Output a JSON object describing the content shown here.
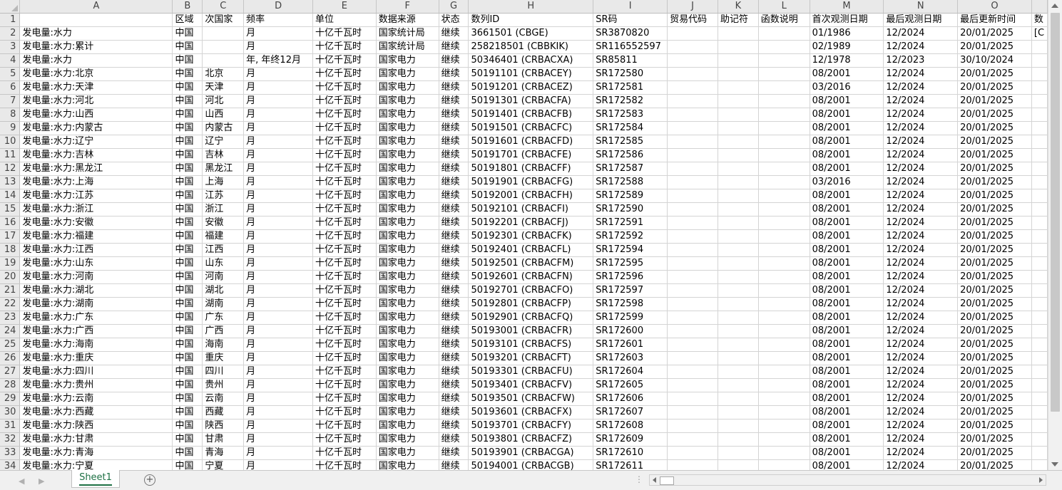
{
  "columns": [
    "A",
    "B",
    "C",
    "D",
    "E",
    "F",
    "G",
    "H",
    "I",
    "J",
    "K",
    "L",
    "M",
    "N",
    "O",
    ""
  ],
  "header_row": [
    "",
    "区域",
    "次国家",
    "频率",
    "单位",
    "数据来源",
    "状态",
    "数列ID",
    "SR码",
    "贸易代码",
    "助记符",
    "函数说明",
    "首次观测日期",
    "最后观测日期",
    "最后更新时间",
    "数"
  ],
  "rows": [
    [
      "发电量:水力",
      "中国",
      "",
      "月",
      "十亿千瓦时",
      "国家统计局",
      "继续",
      "3661501 (CBGE)",
      "SR3870820",
      "",
      "",
      "",
      "01/1986",
      "12/2024",
      "20/01/2025",
      "[C"
    ],
    [
      "发电量:水力:累计",
      "中国",
      "",
      "月",
      "十亿千瓦时",
      "国家统计局",
      "继续",
      "258218501 (CBBKIK)",
      "SR116552597",
      "",
      "",
      "",
      "02/1989",
      "12/2024",
      "20/01/2025",
      ""
    ],
    [
      "发电量:水力",
      "中国",
      "",
      "年, 年终12月",
      "十亿千瓦时",
      "国家电力",
      "继续",
      "50346401 (CRBACXA)",
      "SR85811",
      "",
      "",
      "",
      "12/1978",
      "12/2023",
      "30/10/2024",
      ""
    ],
    [
      "发电量:水力:北京",
      "中国",
      "北京",
      "月",
      "十亿千瓦时",
      "国家电力",
      "继续",
      "50191101 (CRBACEY)",
      "SR172580",
      "",
      "",
      "",
      "08/2001",
      "12/2024",
      "20/01/2025",
      ""
    ],
    [
      "发电量:水力:天津",
      "中国",
      "天津",
      "月",
      "十亿千瓦时",
      "国家电力",
      "继续",
      "50191201 (CRBACEZ)",
      "SR172581",
      "",
      "",
      "",
      "03/2016",
      "12/2024",
      "20/01/2025",
      ""
    ],
    [
      "发电量:水力:河北",
      "中国",
      "河北",
      "月",
      "十亿千瓦时",
      "国家电力",
      "继续",
      "50191301 (CRBACFA)",
      "SR172582",
      "",
      "",
      "",
      "08/2001",
      "12/2024",
      "20/01/2025",
      ""
    ],
    [
      "发电量:水力:山西",
      "中国",
      "山西",
      "月",
      "十亿千瓦时",
      "国家电力",
      "继续",
      "50191401 (CRBACFB)",
      "SR172583",
      "",
      "",
      "",
      "08/2001",
      "12/2024",
      "20/01/2025",
      ""
    ],
    [
      "发电量:水力:内蒙古",
      "中国",
      "内蒙古",
      "月",
      "十亿千瓦时",
      "国家电力",
      "继续",
      "50191501 (CRBACFC)",
      "SR172584",
      "",
      "",
      "",
      "08/2001",
      "12/2024",
      "20/01/2025",
      ""
    ],
    [
      "发电量:水力:辽宁",
      "中国",
      "辽宁",
      "月",
      "十亿千瓦时",
      "国家电力",
      "继续",
      "50191601 (CRBACFD)",
      "SR172585",
      "",
      "",
      "",
      "08/2001",
      "12/2024",
      "20/01/2025",
      ""
    ],
    [
      "发电量:水力:吉林",
      "中国",
      "吉林",
      "月",
      "十亿千瓦时",
      "国家电力",
      "继续",
      "50191701 (CRBACFE)",
      "SR172586",
      "",
      "",
      "",
      "08/2001",
      "12/2024",
      "20/01/2025",
      ""
    ],
    [
      "发电量:水力:黑龙江",
      "中国",
      "黑龙江",
      "月",
      "十亿千瓦时",
      "国家电力",
      "继续",
      "50191801 (CRBACFF)",
      "SR172587",
      "",
      "",
      "",
      "08/2001",
      "12/2024",
      "20/01/2025",
      ""
    ],
    [
      "发电量:水力:上海",
      "中国",
      "上海",
      "月",
      "十亿千瓦时",
      "国家电力",
      "继续",
      "50191901 (CRBACFG)",
      "SR172588",
      "",
      "",
      "",
      "03/2016",
      "12/2024",
      "20/01/2025",
      ""
    ],
    [
      "发电量:水力:江苏",
      "中国",
      "江苏",
      "月",
      "十亿千瓦时",
      "国家电力",
      "继续",
      "50192001 (CRBACFH)",
      "SR172589",
      "",
      "",
      "",
      "08/2001",
      "12/2024",
      "20/01/2025",
      ""
    ],
    [
      "发电量:水力:浙江",
      "中国",
      "浙江",
      "月",
      "十亿千瓦时",
      "国家电力",
      "继续",
      "50192101 (CRBACFI)",
      "SR172590",
      "",
      "",
      "",
      "08/2001",
      "12/2024",
      "20/01/2025",
      ""
    ],
    [
      "发电量:水力:安徽",
      "中国",
      "安徽",
      "月",
      "十亿千瓦时",
      "国家电力",
      "继续",
      "50192201 (CRBACFJ)",
      "SR172591",
      "",
      "",
      "",
      "08/2001",
      "12/2024",
      "20/01/2025",
      ""
    ],
    [
      "发电量:水力:福建",
      "中国",
      "福建",
      "月",
      "十亿千瓦时",
      "国家电力",
      "继续",
      "50192301 (CRBACFK)",
      "SR172592",
      "",
      "",
      "",
      "08/2001",
      "12/2024",
      "20/01/2025",
      ""
    ],
    [
      "发电量:水力:江西",
      "中国",
      "江西",
      "月",
      "十亿千瓦时",
      "国家电力",
      "继续",
      "50192401 (CRBACFL)",
      "SR172594",
      "",
      "",
      "",
      "08/2001",
      "12/2024",
      "20/01/2025",
      ""
    ],
    [
      "发电量:水力:山东",
      "中国",
      "山东",
      "月",
      "十亿千瓦时",
      "国家电力",
      "继续",
      "50192501 (CRBACFM)",
      "SR172595",
      "",
      "",
      "",
      "08/2001",
      "12/2024",
      "20/01/2025",
      ""
    ],
    [
      "发电量:水力:河南",
      "中国",
      "河南",
      "月",
      "十亿千瓦时",
      "国家电力",
      "继续",
      "50192601 (CRBACFN)",
      "SR172596",
      "",
      "",
      "",
      "08/2001",
      "12/2024",
      "20/01/2025",
      ""
    ],
    [
      "发电量:水力:湖北",
      "中国",
      "湖北",
      "月",
      "十亿千瓦时",
      "国家电力",
      "继续",
      "50192701 (CRBACFO)",
      "SR172597",
      "",
      "",
      "",
      "08/2001",
      "12/2024",
      "20/01/2025",
      ""
    ],
    [
      "发电量:水力:湖南",
      "中国",
      "湖南",
      "月",
      "十亿千瓦时",
      "国家电力",
      "继续",
      "50192801 (CRBACFP)",
      "SR172598",
      "",
      "",
      "",
      "08/2001",
      "12/2024",
      "20/01/2025",
      ""
    ],
    [
      "发电量:水力:广东",
      "中国",
      "广东",
      "月",
      "十亿千瓦时",
      "国家电力",
      "继续",
      "50192901 (CRBACFQ)",
      "SR172599",
      "",
      "",
      "",
      "08/2001",
      "12/2024",
      "20/01/2025",
      ""
    ],
    [
      "发电量:水力:广西",
      "中国",
      "广西",
      "月",
      "十亿千瓦时",
      "国家电力",
      "继续",
      "50193001 (CRBACFR)",
      "SR172600",
      "",
      "",
      "",
      "08/2001",
      "12/2024",
      "20/01/2025",
      ""
    ],
    [
      "发电量:水力:海南",
      "中国",
      "海南",
      "月",
      "十亿千瓦时",
      "国家电力",
      "继续",
      "50193101 (CRBACFS)",
      "SR172601",
      "",
      "",
      "",
      "08/2001",
      "12/2024",
      "20/01/2025",
      ""
    ],
    [
      "发电量:水力:重庆",
      "中国",
      "重庆",
      "月",
      "十亿千瓦时",
      "国家电力",
      "继续",
      "50193201 (CRBACFT)",
      "SR172603",
      "",
      "",
      "",
      "08/2001",
      "12/2024",
      "20/01/2025",
      ""
    ],
    [
      "发电量:水力:四川",
      "中国",
      "四川",
      "月",
      "十亿千瓦时",
      "国家电力",
      "继续",
      "50193301 (CRBACFU)",
      "SR172604",
      "",
      "",
      "",
      "08/2001",
      "12/2024",
      "20/01/2025",
      ""
    ],
    [
      "发电量:水力:贵州",
      "中国",
      "贵州",
      "月",
      "十亿千瓦时",
      "国家电力",
      "继续",
      "50193401 (CRBACFV)",
      "SR172605",
      "",
      "",
      "",
      "08/2001",
      "12/2024",
      "20/01/2025",
      ""
    ],
    [
      "发电量:水力:云南",
      "中国",
      "云南",
      "月",
      "十亿千瓦时",
      "国家电力",
      "继续",
      "50193501 (CRBACFW)",
      "SR172606",
      "",
      "",
      "",
      "08/2001",
      "12/2024",
      "20/01/2025",
      ""
    ],
    [
      "发电量:水力:西藏",
      "中国",
      "西藏",
      "月",
      "十亿千瓦时",
      "国家电力",
      "继续",
      "50193601 (CRBACFX)",
      "SR172607",
      "",
      "",
      "",
      "08/2001",
      "12/2024",
      "20/01/2025",
      ""
    ],
    [
      "发电量:水力:陕西",
      "中国",
      "陕西",
      "月",
      "十亿千瓦时",
      "国家电力",
      "继续",
      "50193701 (CRBACFY)",
      "SR172608",
      "",
      "",
      "",
      "08/2001",
      "12/2024",
      "20/01/2025",
      ""
    ],
    [
      "发电量:水力:甘肃",
      "中国",
      "甘肃",
      "月",
      "十亿千瓦时",
      "国家电力",
      "继续",
      "50193801 (CRBACFZ)",
      "SR172609",
      "",
      "",
      "",
      "08/2001",
      "12/2024",
      "20/01/2025",
      ""
    ],
    [
      "发电量:水力:青海",
      "中国",
      "青海",
      "月",
      "十亿千瓦时",
      "国家电力",
      "继续",
      "50193901 (CRBACGA)",
      "SR172610",
      "",
      "",
      "",
      "08/2001",
      "12/2024",
      "20/01/2025",
      ""
    ],
    [
      "发电量:水力:宁夏",
      "中国",
      "宁夏",
      "月",
      "十亿千瓦时",
      "国家电力",
      "继续",
      "50194001 (CRBACGB)",
      "SR172611",
      "",
      "",
      "",
      "08/2001",
      "12/2024",
      "20/01/2025",
      ""
    ]
  ],
  "sheet_tab": {
    "label": "Sheet1"
  },
  "add_sheet_icon": "plus-circle-icon",
  "colors": {
    "tab_accent": "#1e7145",
    "header_bg": "#e9e9e9",
    "grid_line": "#d4d4d4"
  }
}
